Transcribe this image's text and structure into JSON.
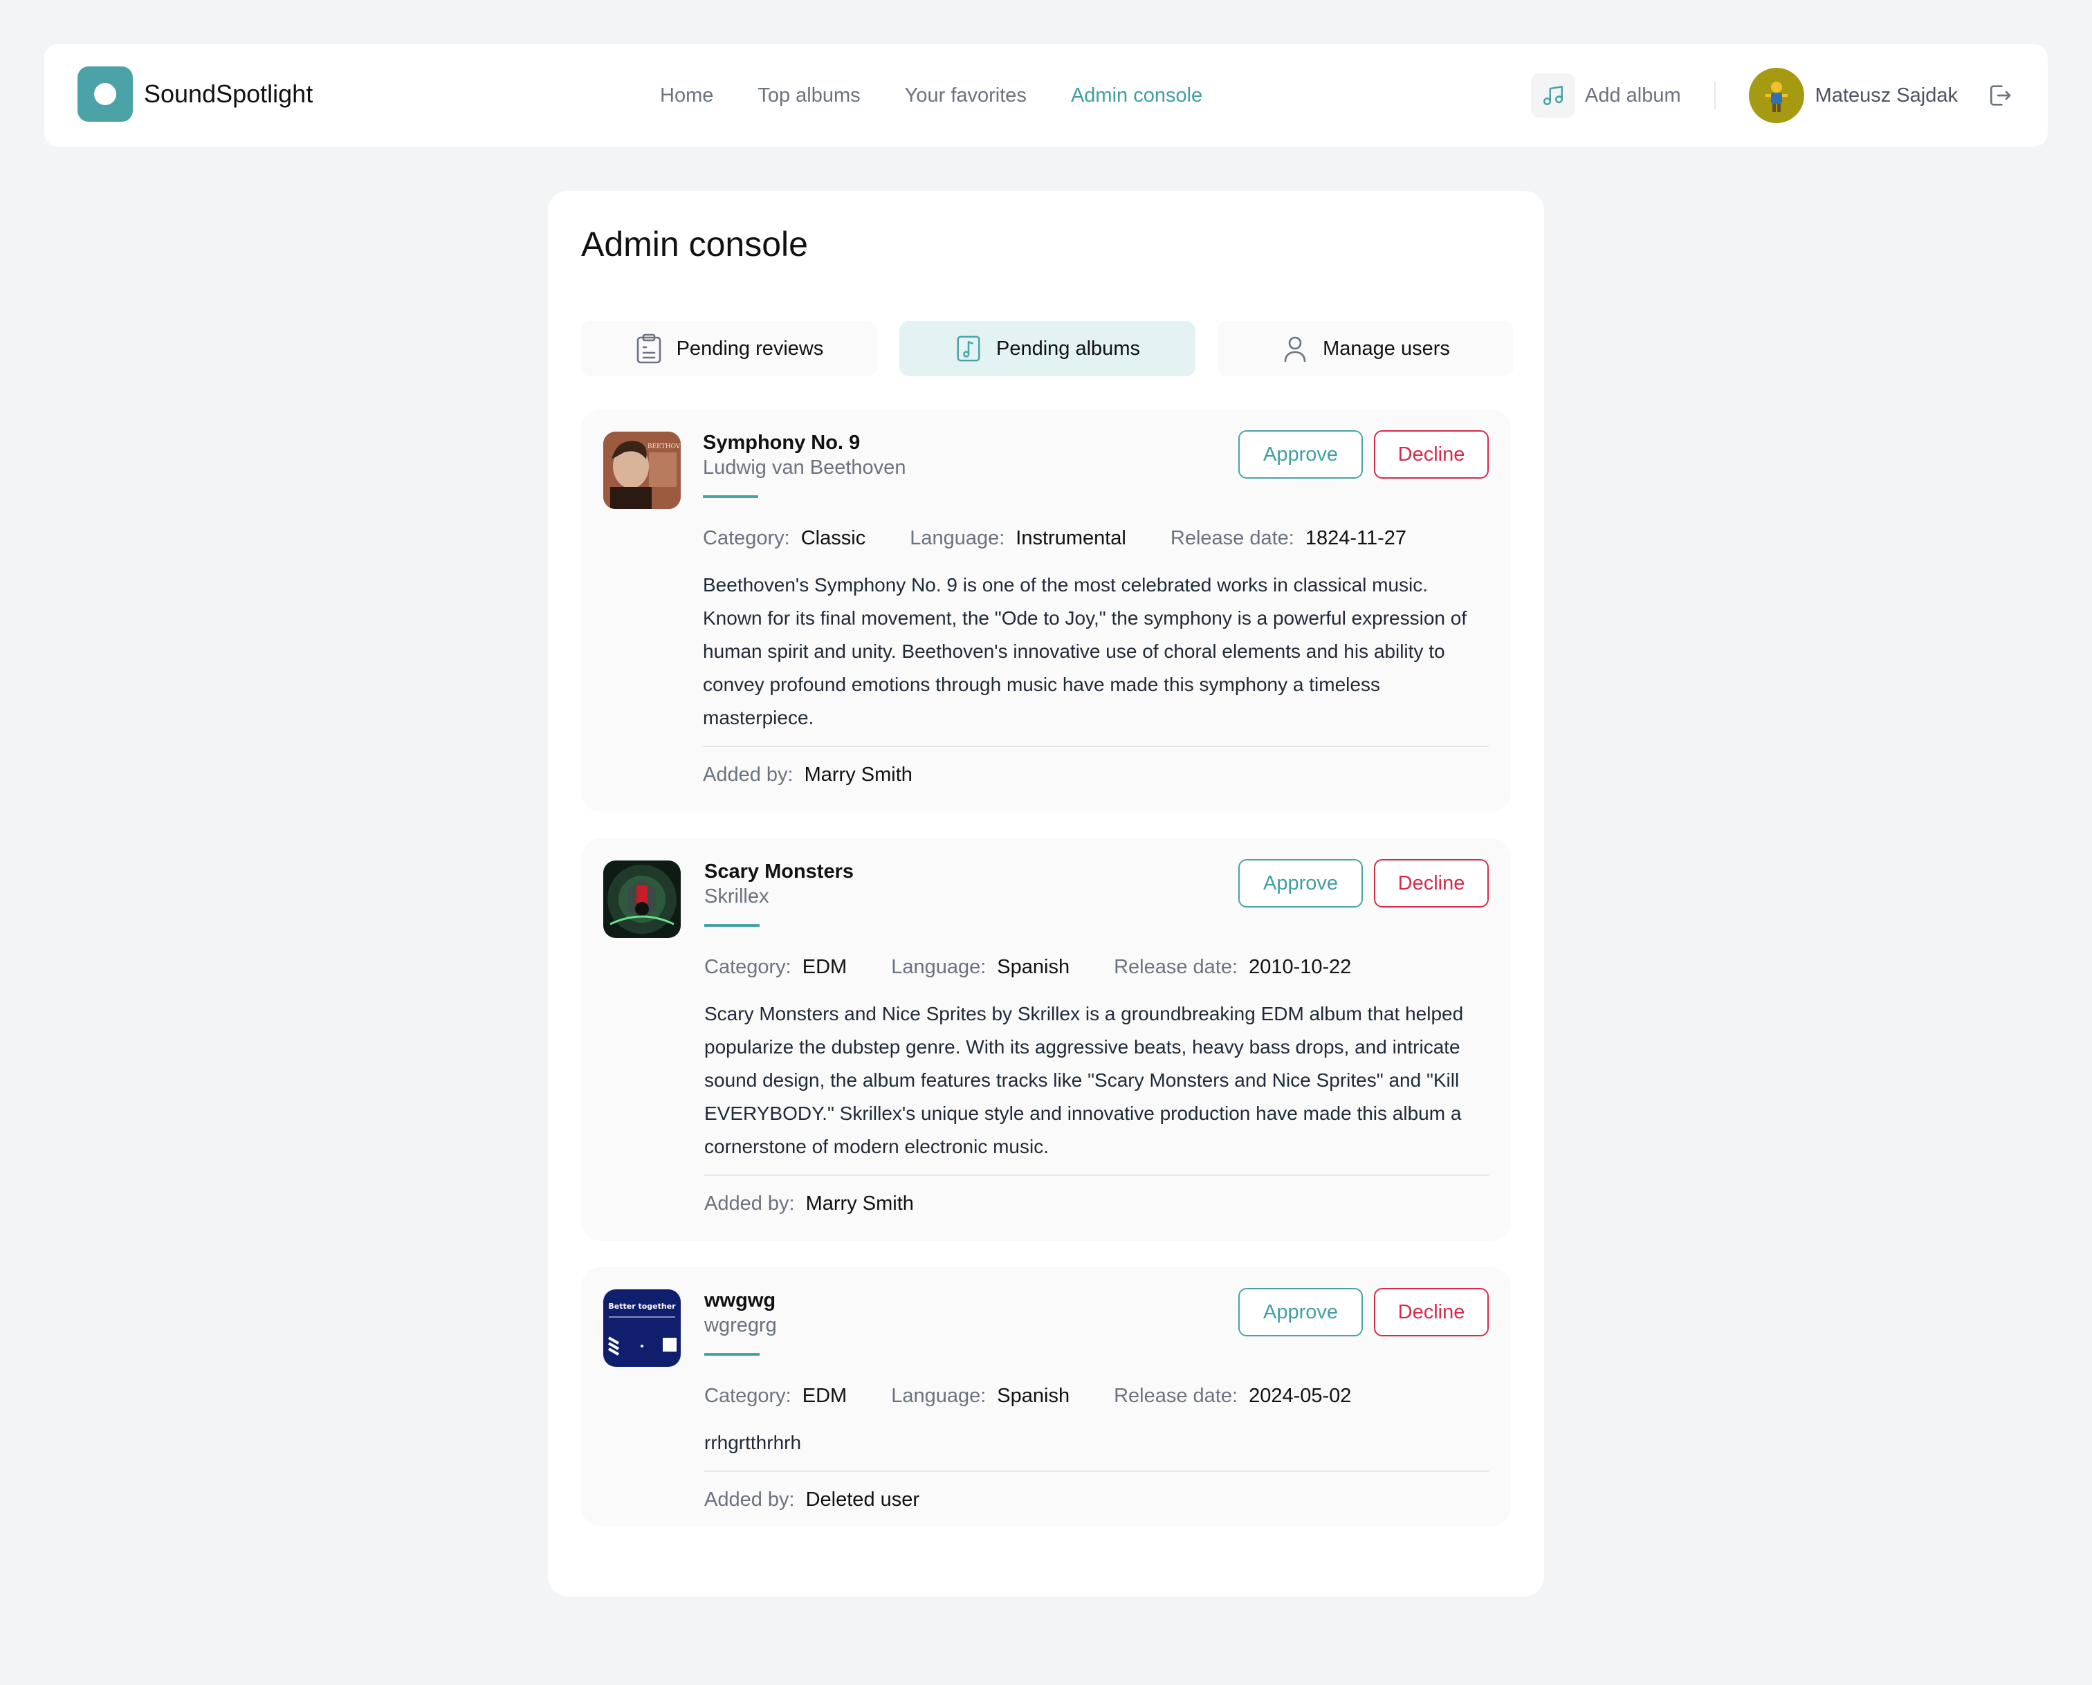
{
  "app": {
    "name": "SoundSpotlight"
  },
  "nav": {
    "links": [
      {
        "label": "Home",
        "active": false
      },
      {
        "label": "Top albums",
        "active": false
      },
      {
        "label": "Your favorites",
        "active": false
      },
      {
        "label": "Admin console",
        "active": true
      }
    ]
  },
  "header": {
    "add_album_label": "Add album",
    "add_album_icon": "music-note-icon",
    "user_name": "Mateusz Sajdak",
    "logout_icon": "logout-icon"
  },
  "page": {
    "title": "Admin console"
  },
  "tabs": [
    {
      "label": "Pending reviews",
      "icon": "clipboard-list-icon",
      "active": false
    },
    {
      "label": "Pending albums",
      "icon": "music-file-icon",
      "active": true
    },
    {
      "label": "Manage users",
      "icon": "user-icon",
      "active": false
    }
  ],
  "labels": {
    "approve": "Approve",
    "decline": "Decline",
    "category": "Category:",
    "language": "Language:",
    "release_date": "Release date:",
    "added_by": "Added by:"
  },
  "albums": [
    {
      "title": "Symphony No. 9",
      "artist": "Ludwig van Beethoven",
      "category": "Classic",
      "language": "Instrumental",
      "release_date": "1824-11-27",
      "description": "Beethoven's Symphony No. 9 is one of the most celebrated works in classical music. Known for its final movement, the \"Ode to Joy,\" the symphony is a powerful expression of human spirit and unity. Beethoven's innovative use of choral elements and his ability to convey profound emotions through music have made this symphony a timeless masterpiece.",
      "added_by": "Marry Smith",
      "cover_text": "BEETHOVEN"
    },
    {
      "title": "Scary Monsters",
      "artist": "Skrillex",
      "category": "EDM",
      "language": "Spanish",
      "release_date": "2010-10-22",
      "description": "Scary Monsters and Nice Sprites by Skrillex is a groundbreaking EDM album that helped popularize the dubstep genre. With its aggressive beats, heavy bass drops, and intricate sound design, the album features tracks like \"Scary Monsters and Nice Sprites\" and \"Kill EVERYBODY.\" Skrillex's unique style and innovative production have made this album a cornerstone of modern electronic music.",
      "added_by": "Marry Smith"
    },
    {
      "title": "wwgwg",
      "artist": "wgregrg",
      "category": "EDM",
      "language": "Spanish",
      "release_date": "2024-05-02",
      "description": "rrhgrtthrhrh",
      "added_by": "Deleted user",
      "cover_text": "Better together"
    }
  ],
  "colors": {
    "accent": "#4ba3a8",
    "decline": "#d72a4b",
    "background": "#f3f4f6"
  }
}
